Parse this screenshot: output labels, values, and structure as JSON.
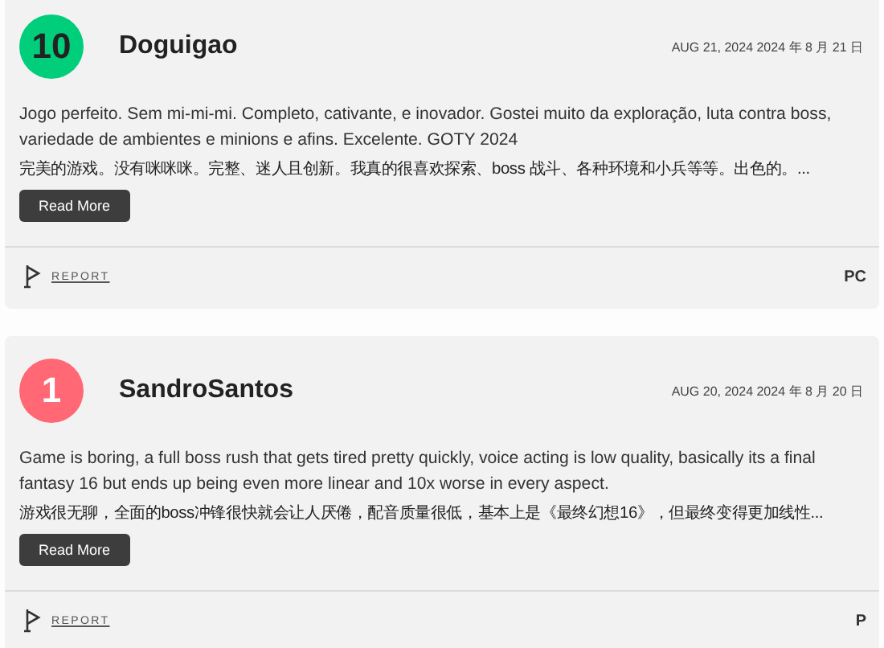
{
  "reviews": [
    {
      "score": "10",
      "color": "#00ce7a",
      "author": "Doguigao",
      "date": "AUG 21, 2024  2024 年 8 月 21 日",
      "text": "Jogo perfeito. Sem mi-mi-mi. Completo, cativante, e inovador. Gostei muito da exploração, luta contra boss, variedade de ambientes e minions e afins. Excelente. GOTY 2024",
      "translation": "完美的游戏。没有咪咪咪。完整、迷人且创新。我真的很喜欢探索、boss 战斗、各种环境和小兵等等。出色的。...",
      "button": "Read More",
      "report": "REPORT",
      "platform": "PC"
    },
    {
      "score": "1",
      "color": "#ff6874",
      "author": "SandroSantos",
      "date": "AUG 20, 2024  2024 年 8 月 20 日",
      "text": "Game is boring, a full boss rush that gets tired pretty quickly, voice acting is low quality, basically its a final fantasy 16 but ends up being even more linear and 10x worse in every aspect.",
      "translation": "游戏很无聊，全面的boss冲锋很快就会让人厌倦，配音质量很低，基本上是《最终幻想16》，但最终变得更加线性...",
      "button": "Read More",
      "report": "REPORT",
      "platform": "P"
    }
  ]
}
